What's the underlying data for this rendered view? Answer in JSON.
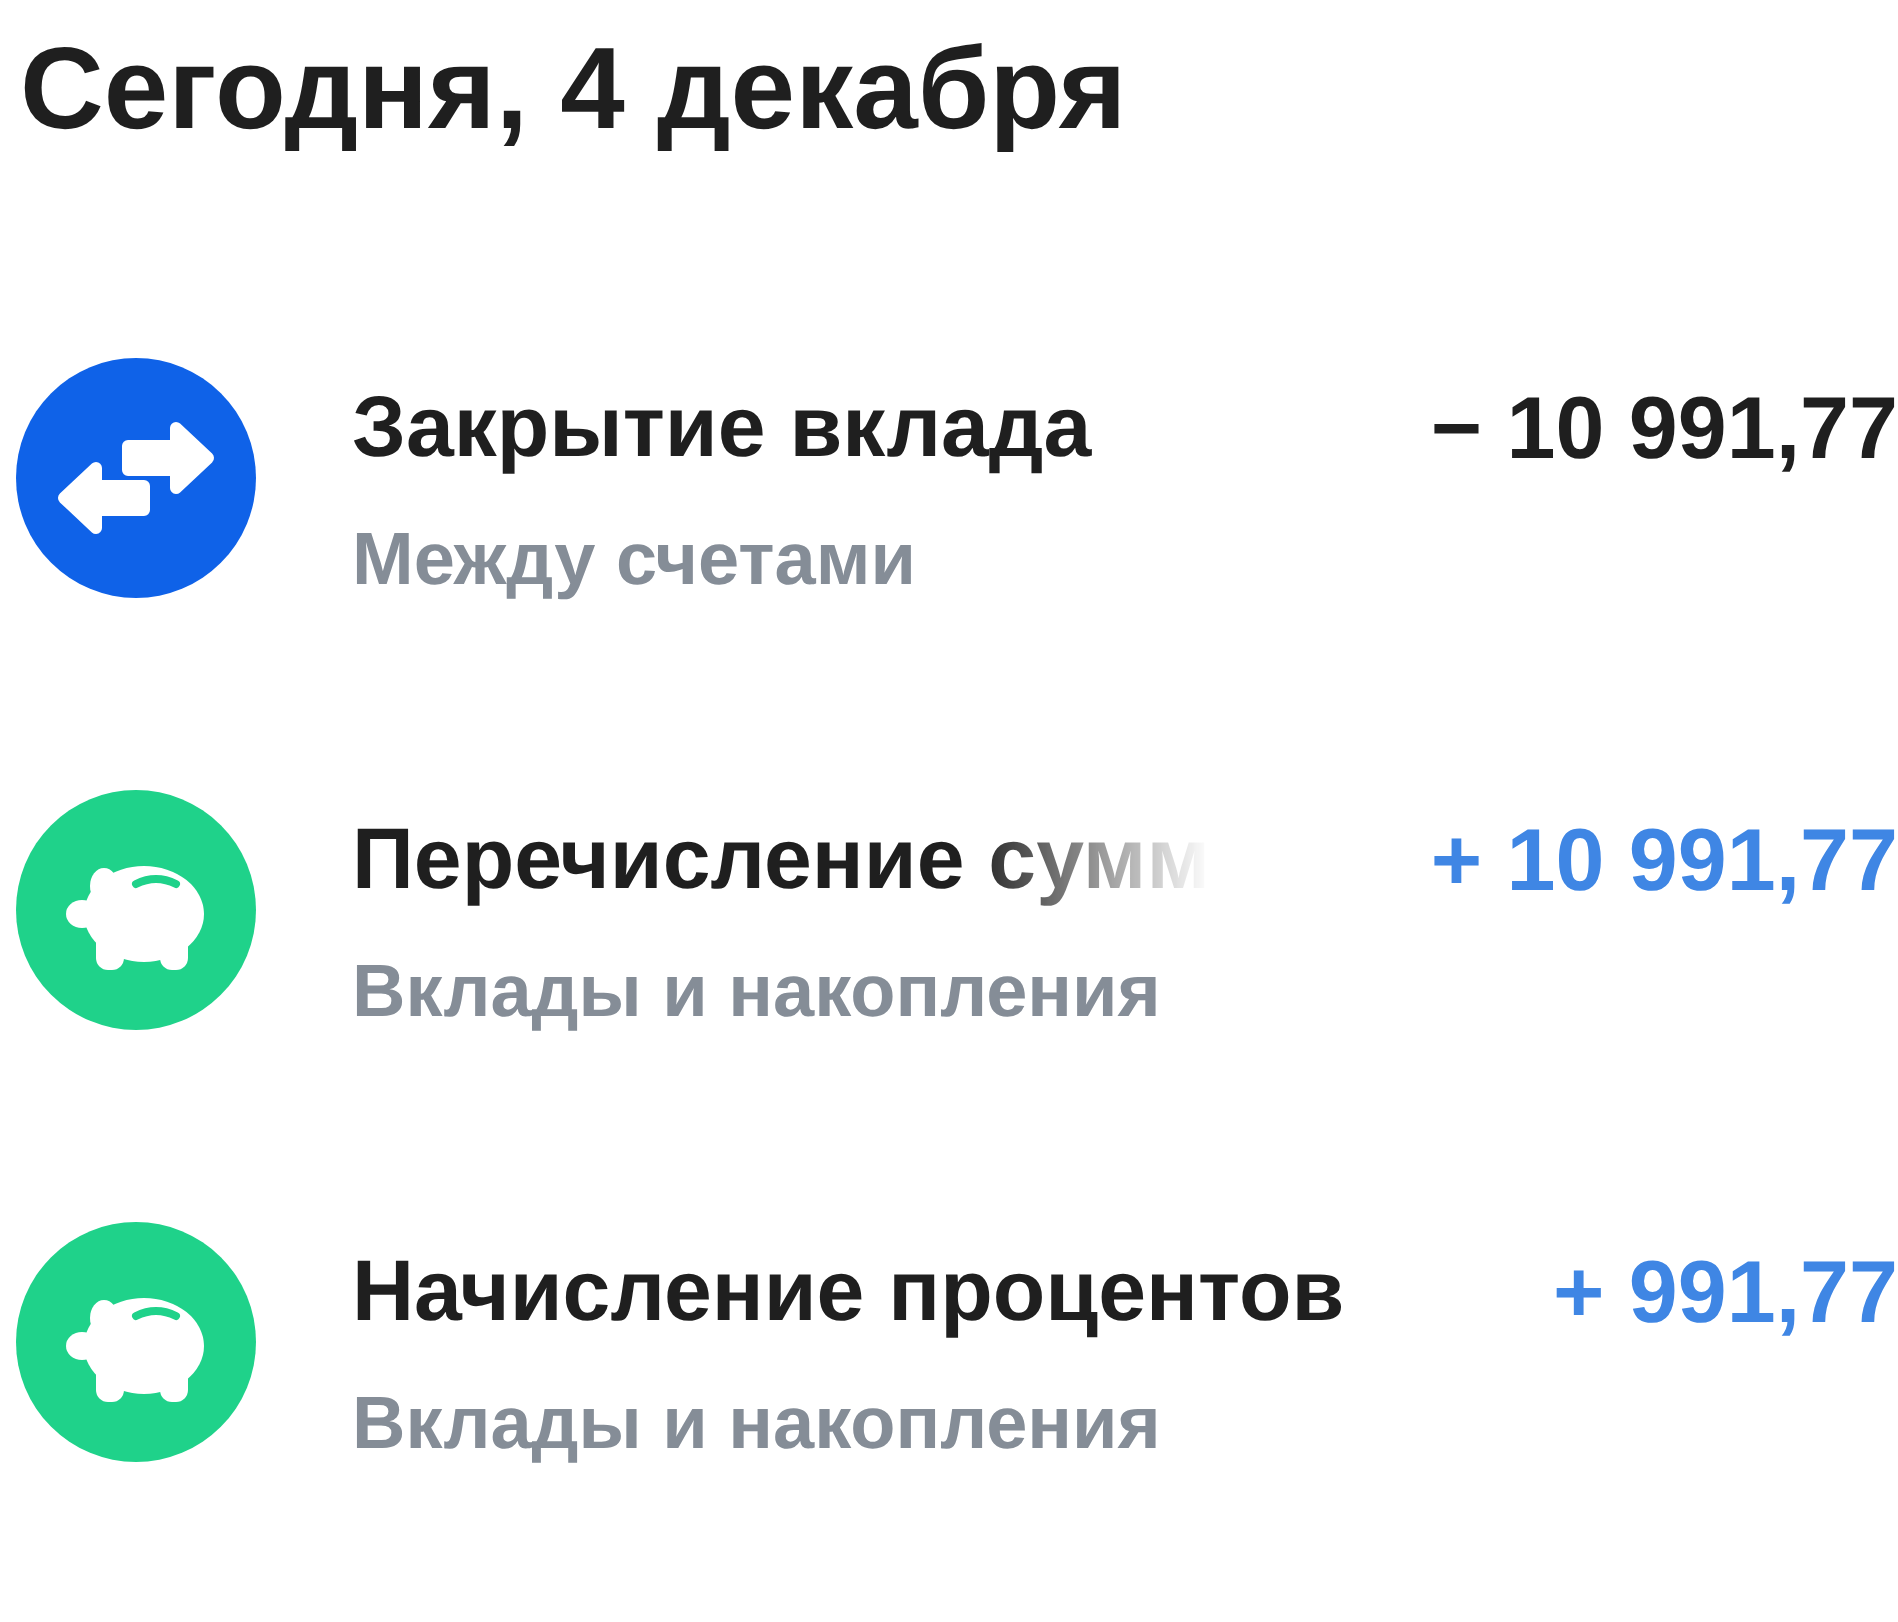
{
  "date_header": "Сегодня, 4 декабря",
  "operations": [
    {
      "kind": "transfer",
      "title": "Закрытие вклада",
      "title_faded": false,
      "category": "Между счетами",
      "amount": "− 10 991,77",
      "color": "#1f1f1f"
    },
    {
      "kind": "piggy",
      "title": "Перечисление сумм",
      "title_faded": true,
      "category": "Вклады и накопления",
      "amount": "+ 10 991,77",
      "color": "#3f86e4"
    },
    {
      "kind": "piggy",
      "title": "Начисление процентов",
      "title_faded": false,
      "category": "Вклады и накопления",
      "amount": "+ 991,77",
      "color": "#3f86e4"
    }
  ]
}
